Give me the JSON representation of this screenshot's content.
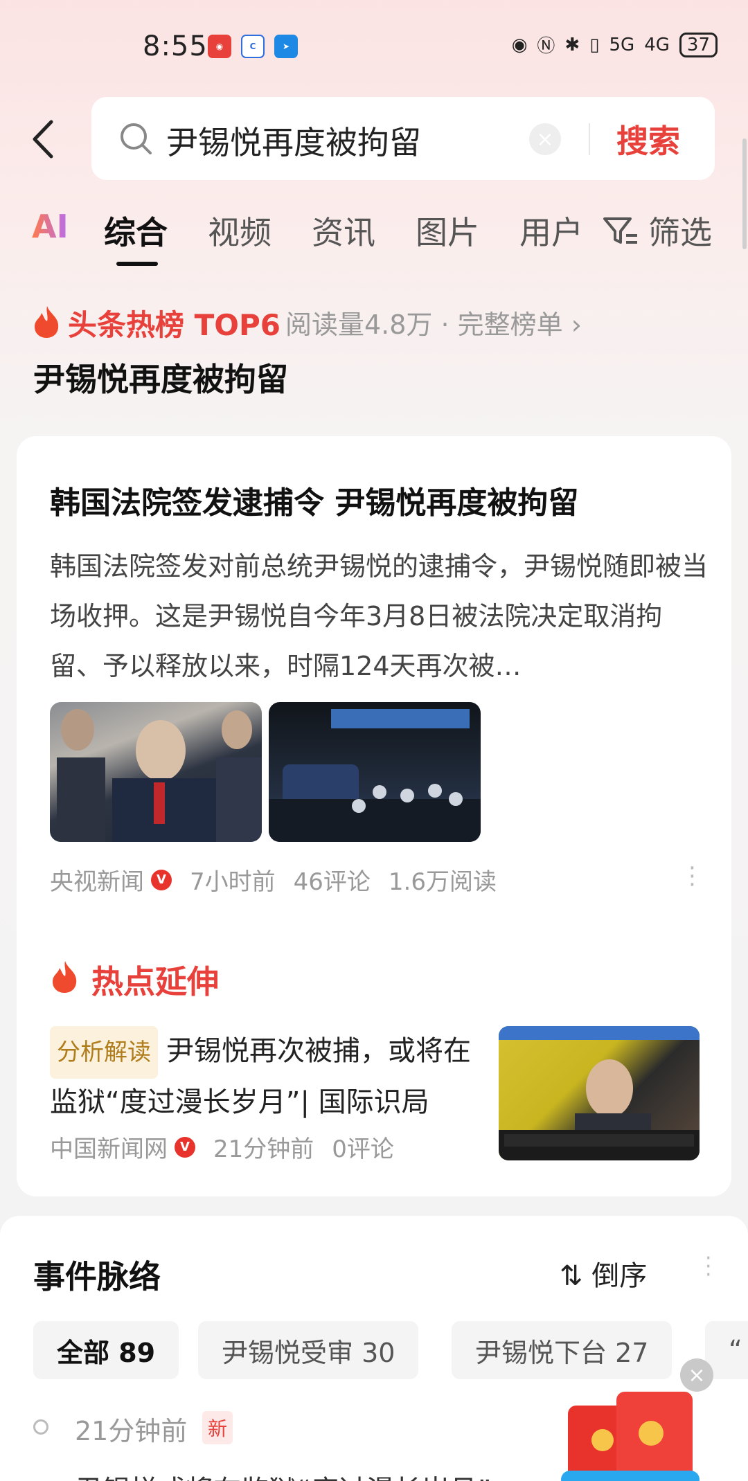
{
  "status": {
    "time": "8:55",
    "battery": "37",
    "network1": "5G",
    "network2": "4G"
  },
  "search": {
    "query": "尹锡悦再度被拘留",
    "submit_label": "搜索"
  },
  "tabs": [
    {
      "label": "AI"
    },
    {
      "label": "综合"
    },
    {
      "label": "视频"
    },
    {
      "label": "资讯"
    },
    {
      "label": "图片"
    },
    {
      "label": "用户"
    },
    {
      "label": "筛选"
    }
  ],
  "hot": {
    "label": "头条热榜 TOP6",
    "meta": "阅读量4.8万 · 完整榜单 ›",
    "title": "尹锡悦再度被拘留"
  },
  "article": {
    "title": "韩国法院签发逮捕令 尹锡悦再度被拘留",
    "body": "韩国法院签发对前总统尹锡悦的逮捕令，尹锡悦随即被当场收押。这是尹锡悦自今年3月8日被法院决定取消拘留、予以释放以来，时隔124天再次被…",
    "source": "央视新闻",
    "time": "7小时前",
    "comments": "46评论",
    "reads": "1.6万阅读"
  },
  "extension": {
    "label": "热点延伸",
    "tag": "分析解读",
    "text": "尹锡悦再次被捕，或将在监狱“度过漫长岁月”| 国际识局",
    "source": "中国新闻网",
    "time": "21分钟前",
    "comments": "0评论"
  },
  "event": {
    "title": "事件脉络",
    "sort_label": "倒序",
    "chips": [
      {
        "label": "全部 89"
      },
      {
        "label": "尹锡悦受审 30"
      },
      {
        "label": "尹锡悦下台 27"
      },
      {
        "label": "“"
      }
    ],
    "timeline_time": "21分钟前",
    "timeline_new": "新",
    "timeline_next": "尹锡悦或将在监狱“度过漫长岁月”"
  }
}
